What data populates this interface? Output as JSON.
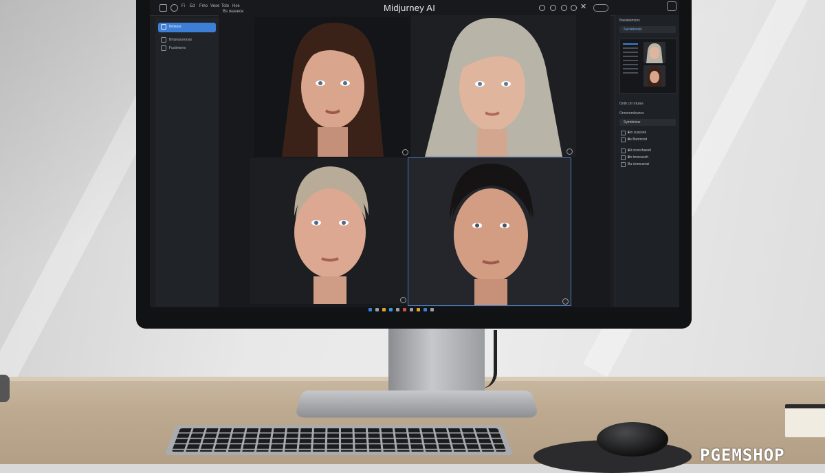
{
  "app": {
    "title": "Midjurney AI"
  },
  "titlebar": {
    "menus": [
      "Fi",
      "Ed",
      "Fmo",
      "Vese",
      "Tolo",
      "Hse"
    ],
    "search_label": "Bs reauece"
  },
  "sidebar": {
    "items": [
      {
        "label": "Nrrisors",
        "icon": "home-icon",
        "active": true
      },
      {
        "label": "Bmpoacestoas",
        "icon": "grid-icon",
        "active": false
      },
      {
        "label": "Fustinwers",
        "icon": "list-icon",
        "active": false
      }
    ]
  },
  "grid": {
    "images": [
      {
        "name": "portrait-dark-hair-woman",
        "hair": "#3a2219",
        "skin": "#d9a58c",
        "bg": "#141518"
      },
      {
        "name": "portrait-silver-hair-woman",
        "hair": "#b9b4a8",
        "skin": "#e0b59e",
        "bg": "#1d1f23"
      },
      {
        "name": "portrait-updo-blonde-woman",
        "hair": "#b8ab97",
        "skin": "#dca891",
        "bg": "#1c1e22"
      },
      {
        "name": "portrait-dark-slicked-hair-woman",
        "hair": "#151313",
        "skin": "#d39d83",
        "bg": "#24262b"
      }
    ],
    "selected_index": 3
  },
  "right_panel": {
    "header": "Baslatsimiors",
    "field_value": "Saclationsis",
    "section_label": "Onth cirr rrtutes",
    "section2_label": "Onnoremibunes",
    "dropdown_value": "Sytmtiniosr",
    "options": [
      "Ein cussnnk",
      "Bs Bunmosit",
      "Sit ocenchaesti",
      "Bn trrorcaxoh",
      "Bu clomcarnsi"
    ]
  },
  "watermark": "PGEMSHOP",
  "colors": {
    "accent": "#3d7fd6",
    "screen_bg": "#1c1e22",
    "panel_bg": "#202327"
  }
}
